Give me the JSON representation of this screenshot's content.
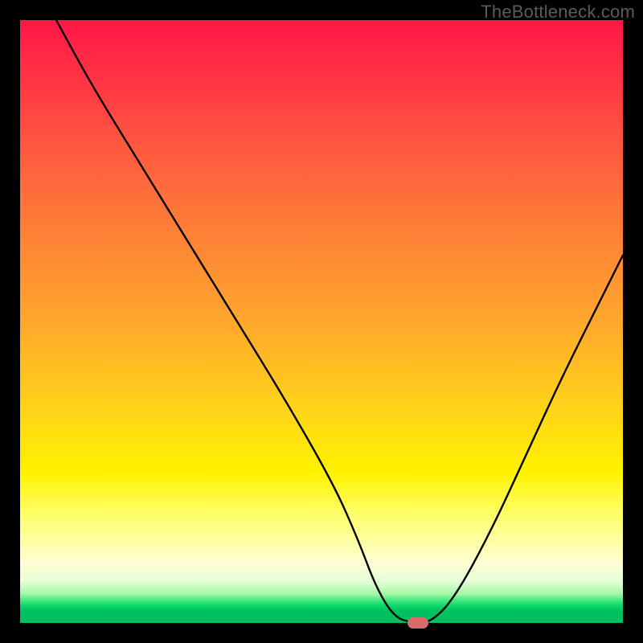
{
  "watermark": "TheBottleneck.com",
  "chart_data": {
    "type": "line",
    "title": "",
    "xlabel": "",
    "ylabel": "",
    "xlim": [
      0,
      100
    ],
    "ylim": [
      0,
      100
    ],
    "grid": false,
    "legend": false,
    "series": [
      {
        "name": "curve",
        "x": [
          6,
          12,
          20,
          28,
          36,
          44,
          52,
          56,
          59,
          62,
          65,
          68,
          72,
          78,
          84,
          90,
          96,
          100
        ],
        "values": [
          100,
          89,
          76,
          63,
          50,
          37,
          23,
          14,
          6,
          1,
          0,
          0,
          4,
          15,
          28,
          41,
          53,
          61
        ]
      }
    ],
    "marker": {
      "x": 66,
      "y": 0,
      "color": "#da6a6b"
    },
    "gradient_stops": [
      {
        "pct": 0,
        "color": "#ff1846"
      },
      {
        "pct": 22,
        "color": "#ff5b3f"
      },
      {
        "pct": 50,
        "color": "#ffa72c"
      },
      {
        "pct": 75,
        "color": "#fff200"
      },
      {
        "pct": 92,
        "color": "#ffffd2"
      },
      {
        "pct": 97,
        "color": "#0bd66c"
      },
      {
        "pct": 100,
        "color": "#00c060"
      }
    ]
  }
}
